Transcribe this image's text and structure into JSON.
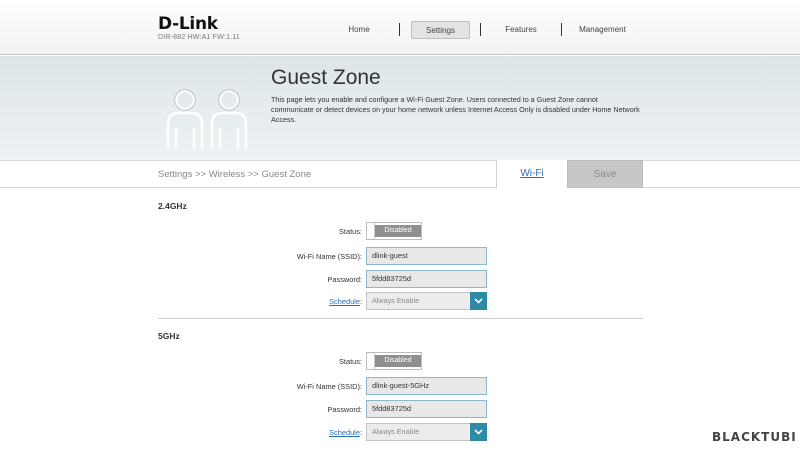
{
  "header": {
    "logo": "D-Link",
    "model": "DIR-882 HW:A1 FW:1.11",
    "nav": [
      "Home",
      "Settings",
      "Features",
      "Management"
    ],
    "active_nav": "Settings"
  },
  "hero": {
    "title": "Guest Zone",
    "description": "This page lets you enable and configure a Wi-Fi Guest Zone. Users connected to a Guest Zone cannot communicate or detect devices on your home network unless Internet Access Only is disabled under Home Network Access.",
    "icon": "two-users-icon"
  },
  "breadcrumb": "Settings >> Wireless >> Guest Zone",
  "tabs": {
    "wifi": "Wi-Fi",
    "save": "Save"
  },
  "bands": [
    {
      "title": "2.4GHz",
      "status_label": "Status:",
      "status_value": "Disabled",
      "ssid_label": "Wi-Fi Name (SSID):",
      "ssid_value": "dlink-guest",
      "password_label": "Password:",
      "password_value": "5fdd83725d",
      "schedule_label": "Schedule",
      "schedule_colon": ":",
      "schedule_value": "Always Enable"
    },
    {
      "title": "5GHz",
      "status_label": "Status:",
      "status_value": "Disabled",
      "ssid_label": "Wi-Fi Name (SSID):",
      "ssid_value": "dlink-guest-5GHz",
      "password_label": "Password:",
      "password_value": "5fdd83725d",
      "schedule_label": "Schedule",
      "schedule_colon": ":",
      "schedule_value": "Always Enable"
    }
  ],
  "watermark": "BLACKTUBI",
  "colors": {
    "accent": "#2d8ba3",
    "link": "#2a6db5",
    "toggle_off": "#8f8f8f"
  }
}
